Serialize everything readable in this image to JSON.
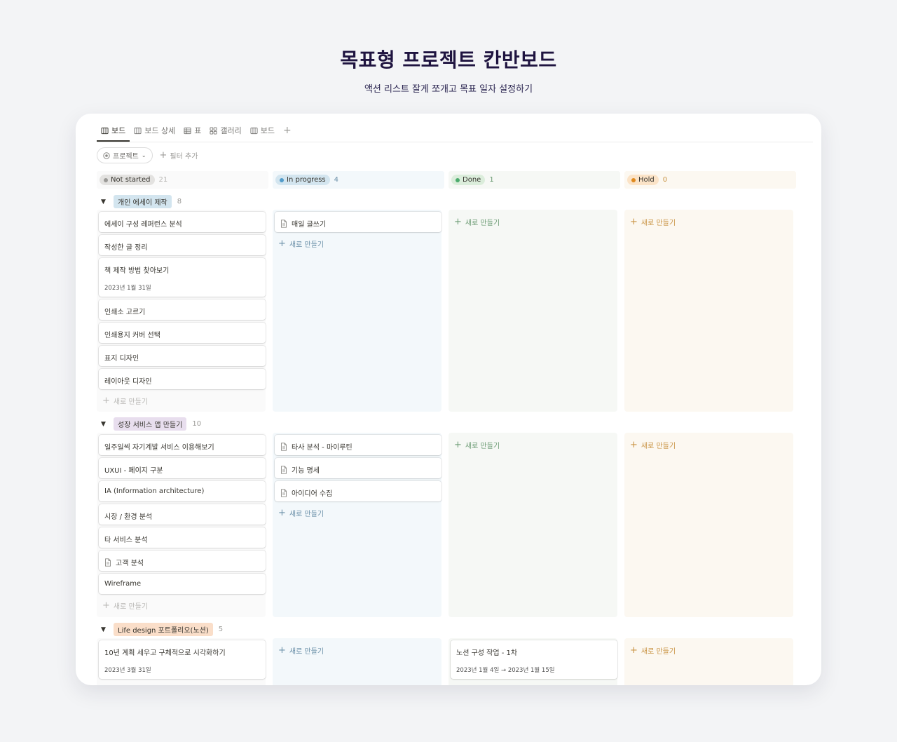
{
  "hero": {
    "title": "목표형 프로젝트 칸반보드",
    "subtitle": "액션 리스트 잘게 쪼개고 목표 일자 설정하기"
  },
  "tabs": [
    {
      "label": "보드",
      "icon": "board-icon",
      "active": true
    },
    {
      "label": "보드 상세",
      "icon": "board-icon"
    },
    {
      "label": "표",
      "icon": "table-icon"
    },
    {
      "label": "갤러리",
      "icon": "gallery-icon"
    },
    {
      "label": "보드",
      "icon": "board-icon"
    }
  ],
  "add_view_label": "+",
  "filters": {
    "project_chip": "프로젝트",
    "add_filter": "필터 추가"
  },
  "columns": [
    {
      "name": "Not started",
      "count": "21",
      "dot": "#9b9a97",
      "pill_bg": "#e3e2e0",
      "count_color": "#b8b7b4",
      "lane_bg": "#fafafa",
      "new_color": "#b8b7b4"
    },
    {
      "name": "In progress",
      "count": "4",
      "dot": "#529cca",
      "pill_bg": "#d3e5ef",
      "count_color": "#6a8fa8",
      "lane_bg": "#f3f8fb",
      "new_color": "#6a8fa8"
    },
    {
      "name": "Done",
      "count": "1",
      "dot": "#4dab6d",
      "pill_bg": "#dbeddb",
      "count_color": "#6a9a72",
      "lane_bg": "#f6f8f5",
      "new_color": "#6a9a72"
    },
    {
      "name": "Hold",
      "count": "0",
      "dot": "#e08a1e",
      "pill_bg": "#fbe3c7",
      "count_color": "#c99343",
      "lane_bg": "#fcf8f1",
      "new_color": "#c99343"
    }
  ],
  "new_label": "새로 만들기",
  "groups": [
    {
      "name": "개인 에세이 제작",
      "count": "8",
      "tag_bg": "#d3e5ef",
      "cards": [
        [
          {
            "title": "에세이 구성 레퍼런스 분석"
          },
          {
            "title": "작성한 글 정리"
          },
          {
            "title": "책 제작 방법 찾아보기",
            "date": "2023년 1월 31일"
          },
          {
            "title": "인쇄소 고르기"
          },
          {
            "title": "인쇄용지 커버 선택"
          },
          {
            "title": "표지 디자인"
          },
          {
            "title": "레이아웃 디자인"
          }
        ],
        [
          {
            "title": "매일 글쓰기",
            "doc": true
          }
        ],
        [],
        []
      ]
    },
    {
      "name": "성장 서비스 앱 만들기",
      "count": "10",
      "tag_bg": "#e8deee",
      "cards": [
        [
          {
            "title": "일주일씩 자기계발 서비스 이용해보기"
          },
          {
            "title": "UXUI - 페이지 구분"
          },
          {
            "title": "IA (Information architecture)"
          },
          {
            "title": "시장 / 환경 분석"
          },
          {
            "title": "타 서비스 분석"
          },
          {
            "title": "고객 분석",
            "doc": true
          },
          {
            "title": "Wireframe"
          }
        ],
        [
          {
            "title": "타사 분석 - 마이루틴",
            "doc": true
          },
          {
            "title": "기능 명세",
            "doc": true
          },
          {
            "title": "아이디어 수집",
            "doc": true
          }
        ],
        [],
        []
      ]
    },
    {
      "name": "Life design 포트폴리오(노션)",
      "count": "5",
      "tag_bg": "#fadec9",
      "cards": [
        [
          {
            "title": "10년 계획 세우고 구체적으로 시각화하기",
            "date": "2023년 3월 31일"
          }
        ],
        [],
        [
          {
            "title": "노션 구성 작업 - 1차",
            "date": "2023년 1월 4일 → 2023년 1월 15일"
          }
        ],
        []
      ]
    }
  ]
}
